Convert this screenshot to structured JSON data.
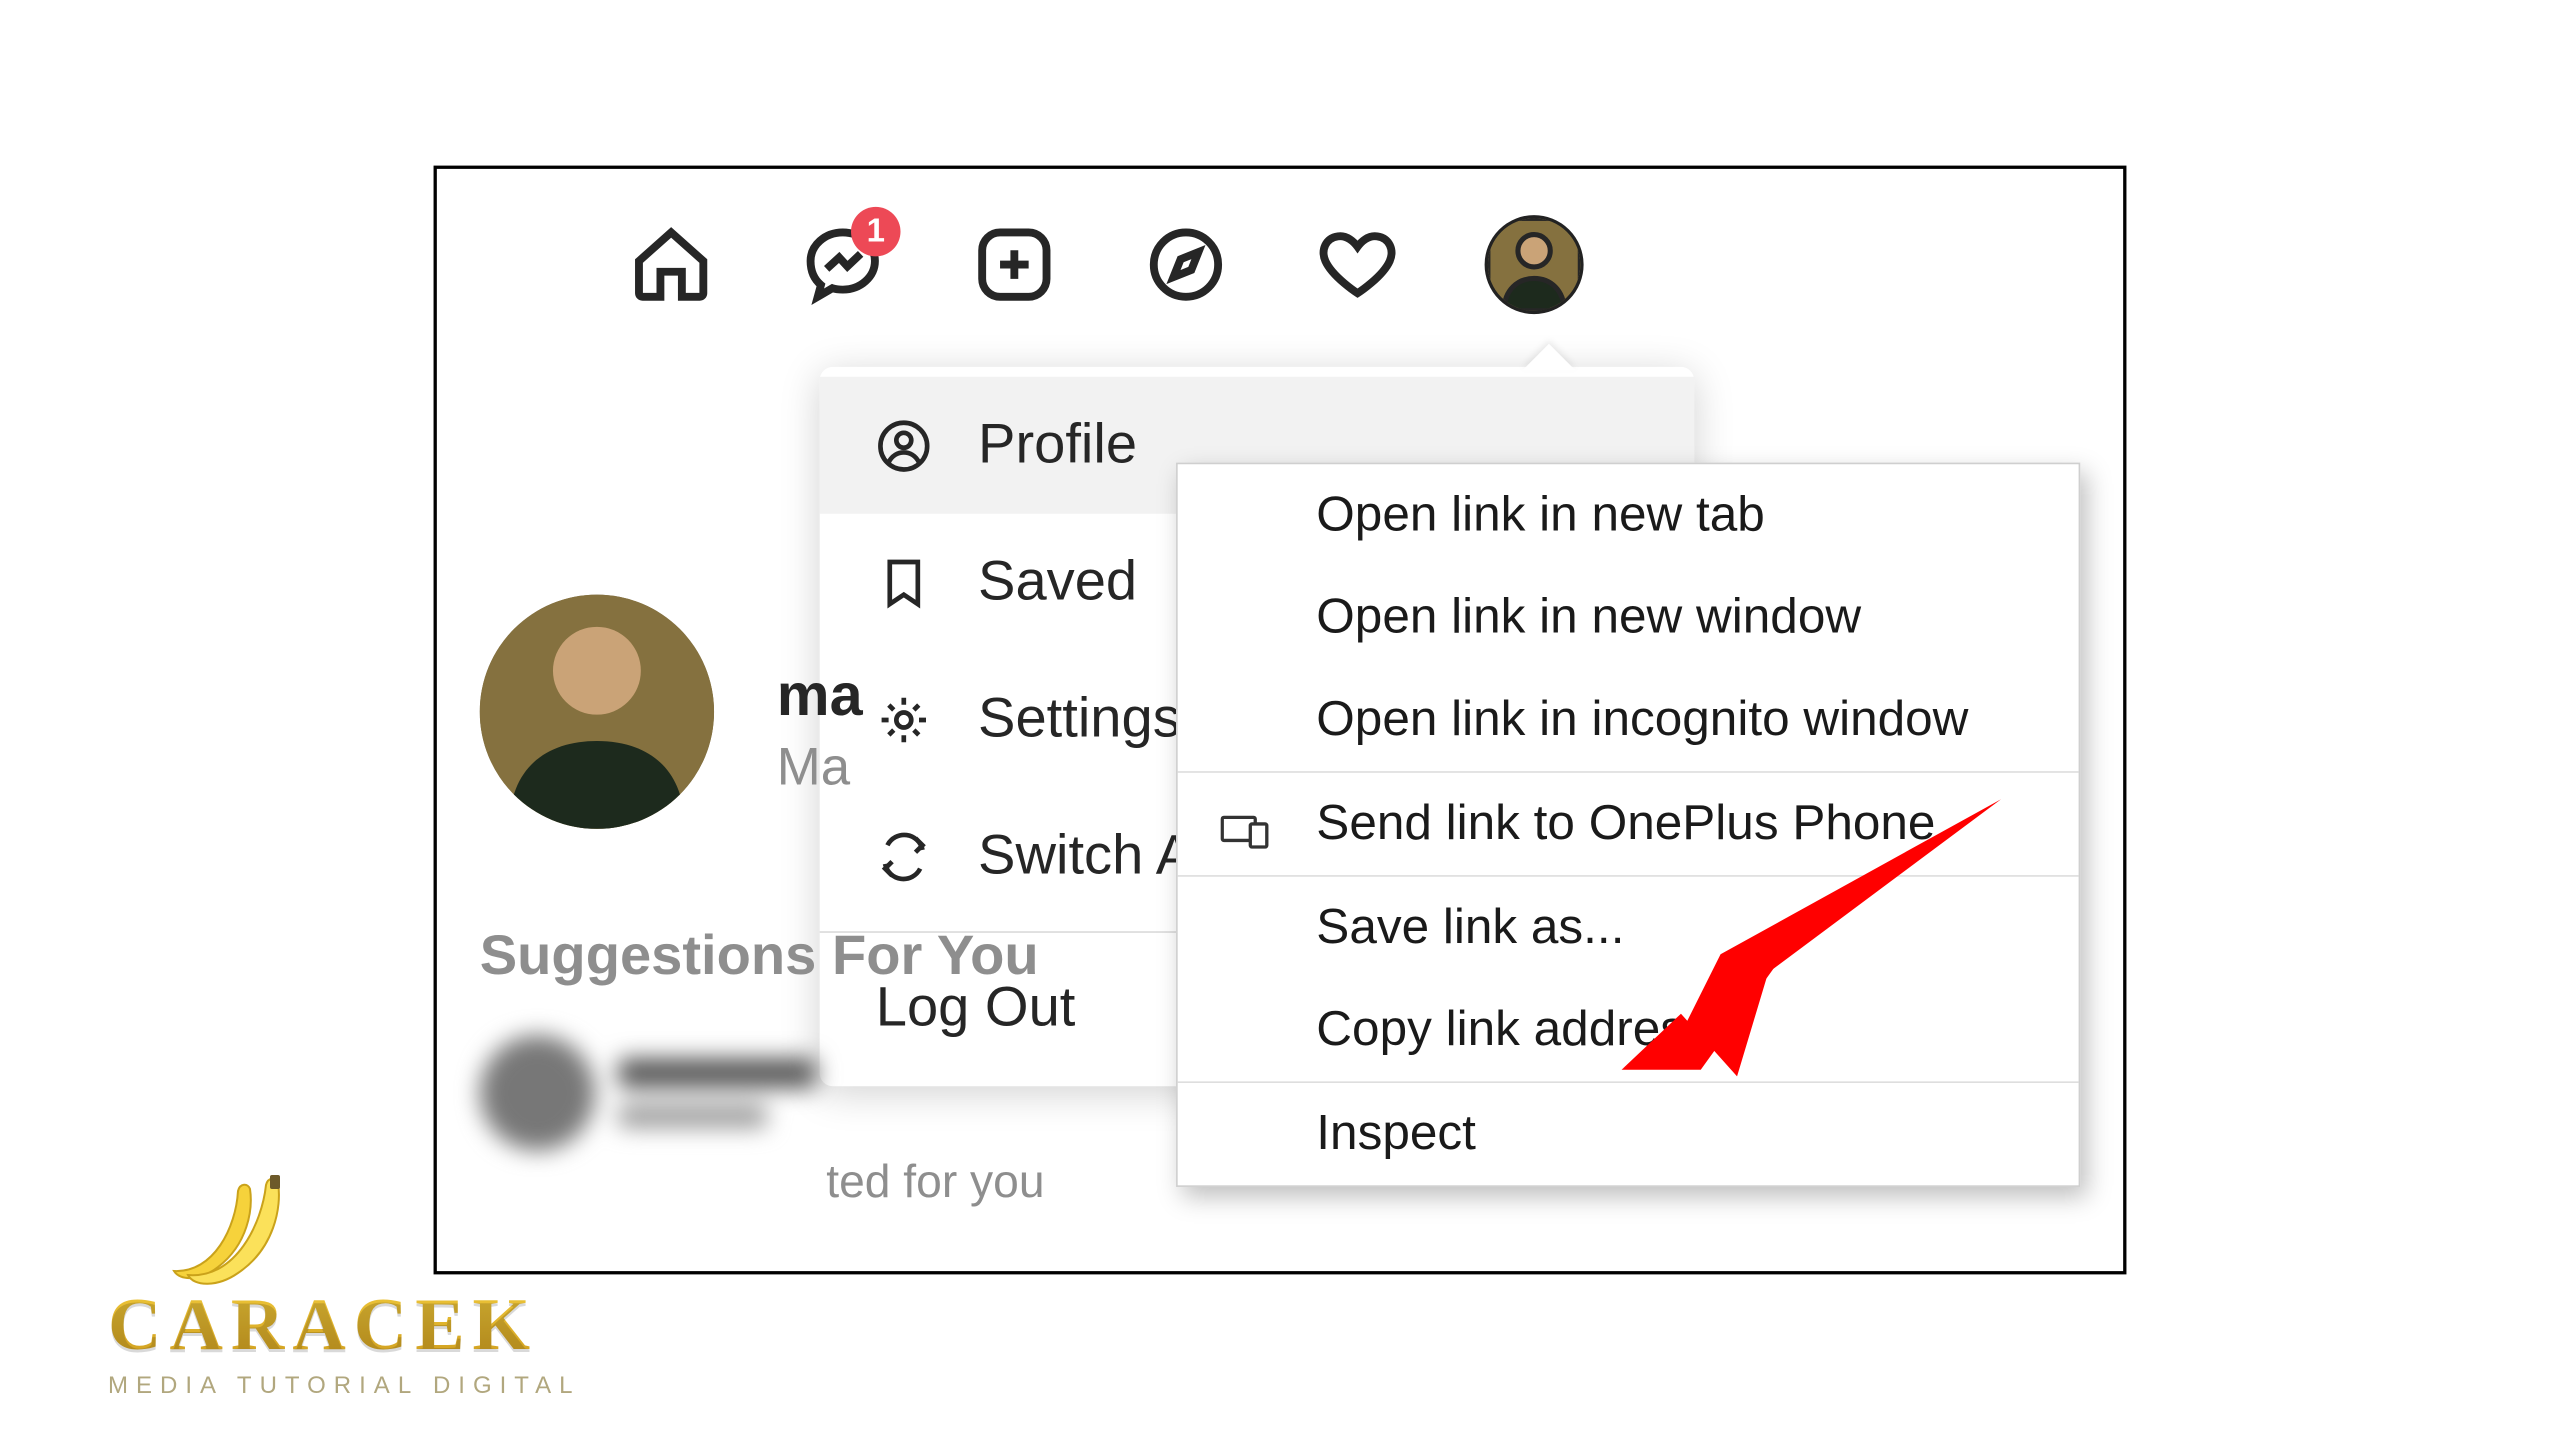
{
  "nav": {
    "badge_count": "1",
    "icons": {
      "home": "home-icon",
      "messenger": "messenger-icon",
      "create": "plus-icon",
      "explore": "compass-icon",
      "activity": "heart-icon",
      "avatar": "avatar-icon"
    }
  },
  "dropdown": {
    "items": [
      {
        "label": "Profile",
        "icon": "user-circle-icon",
        "selected": true
      },
      {
        "label": "Saved",
        "icon": "bookmark-icon",
        "selected": false
      },
      {
        "label": "Settings",
        "icon": "gear-icon",
        "selected": false
      },
      {
        "label": "Switch Accounts",
        "icon": "switch-icon",
        "selected": false
      }
    ],
    "logout_label": "Log Out"
  },
  "context_menu": {
    "items_group1": [
      "Open link in new tab",
      "Open link in new window",
      "Open link in incognito window"
    ],
    "send_to": "Send link to OnePlus Phone",
    "items_group3": [
      "Save link as...",
      "Copy link address"
    ],
    "inspect": "Inspect"
  },
  "sidebar": {
    "username_partial": "ma",
    "fullname_partial": "Ma",
    "suggestions_label": "Suggestions For You",
    "blurred_hint": "ted for you"
  },
  "watermark": {
    "brand": "CARACEK",
    "tagline": "MEDIA TUTORIAL DIGITAL"
  },
  "annotation": {
    "arrow_target": "Copy link address",
    "arrow_color": "#ff0000"
  }
}
